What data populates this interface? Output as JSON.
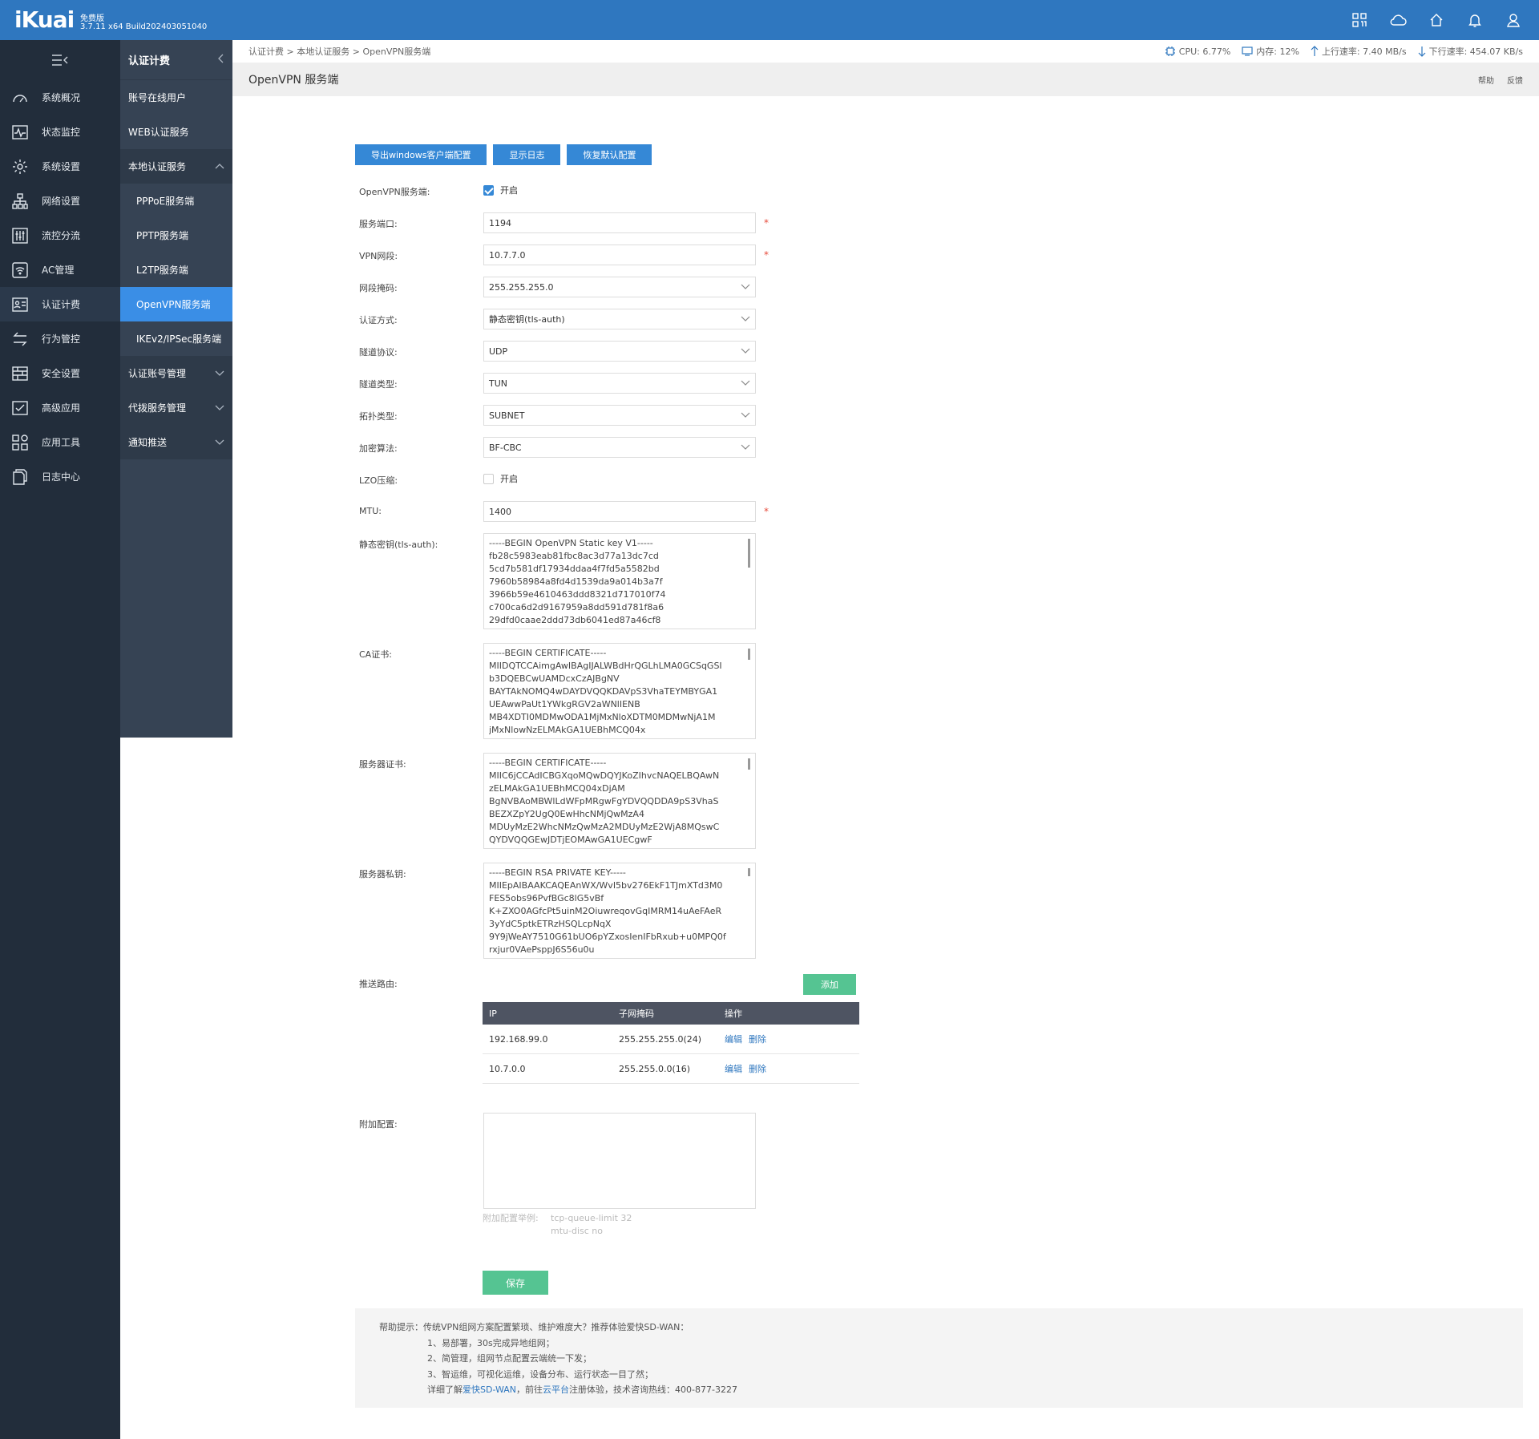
{
  "app": {
    "logo": "iKuai",
    "edition": "免费版",
    "version": "3.7.11 x64 Build202403051040"
  },
  "sidebar": {
    "items": [
      {
        "label": "系统概况",
        "icon": "dashboard-icon"
      },
      {
        "label": "状态监控",
        "icon": "monitor-icon"
      },
      {
        "label": "系统设置",
        "icon": "gear-icon"
      },
      {
        "label": "网络设置",
        "icon": "network-icon"
      },
      {
        "label": "流控分流",
        "icon": "sliders-icon"
      },
      {
        "label": "AC管理",
        "icon": "wifi-icon"
      },
      {
        "label": "认证计费",
        "icon": "id-card-icon"
      },
      {
        "label": "行为管控",
        "icon": "arrows-icon"
      },
      {
        "label": "安全设置",
        "icon": "firewall-icon"
      },
      {
        "label": "高级应用",
        "icon": "check-icon"
      },
      {
        "label": "应用工具",
        "icon": "apps-icon"
      },
      {
        "label": "日志中心",
        "icon": "docs-icon"
      }
    ]
  },
  "submenu": {
    "title": "认证计费",
    "items": [
      "账号在线用户",
      "WEB认证服务",
      "本地认证服务",
      "PPPoE服务端",
      "PPTP服务端",
      "L2TP服务端",
      "OpenVPN服务端",
      "IKEv2/IPSec服务端",
      "认证账号管理",
      "代拨服务管理",
      "通知推送"
    ]
  },
  "breadcrumb": {
    "a": "认证计费",
    "b": "本地认证服务",
    "c": "OpenVPN服务端",
    "sep": ">"
  },
  "stats": {
    "cpu": "CPU: 6.77%",
    "mem": "内存: 12%",
    "up": "上行速率: 7.40 MB/s",
    "down": "下行速率: 454.07 KB/s"
  },
  "page": {
    "title": "OpenVPN 服务端",
    "help": "帮助",
    "feedback": "反馈"
  },
  "buttons": {
    "export": "导出windows客户端配置",
    "log": "显示日志",
    "restore": "恢复默认配置",
    "add": "添加",
    "save": "保存"
  },
  "form": {
    "enable_label": "OpenVPN服务端:",
    "enable_text": "开启",
    "port_label": "服务端口:",
    "port": "1194",
    "net_label": "VPN网段:",
    "net": "10.7.7.0",
    "mask_label": "网段掩码:",
    "mask": "255.255.255.0",
    "auth_label": "认证方式:",
    "auth": "静态密钥(tls-auth)",
    "proto_label": "隧道协议:",
    "proto": "UDP",
    "tun_label": "隧道类型:",
    "tun": "TUN",
    "topo_label": "拓扑类型:",
    "topo": "SUBNET",
    "cipher_label": "加密算法:",
    "cipher": "BF-CBC",
    "lzo_label": "LZO压缩:",
    "lzo_text": "开启",
    "mtu_label": "MTU:",
    "mtu": "1400",
    "key_label": "静态密钥(tls-auth):",
    "ca_label": "CA证书:",
    "cert_label": "服务器证书:",
    "pkey_label": "服务器私钥:",
    "route_label": "推送路由:",
    "extra_label": "附加配置:",
    "extra_hint_label": "附加配置举例:",
    "extra_hint_1": "tcp-queue-limit 32",
    "extra_hint_2": "mtu-disc no",
    "required_mark": "*"
  },
  "static_key": [
    "-----BEGIN OpenVPN Static key V1-----",
    "fb28c5983eab81fbc8ac3d77a13dc7cd",
    "5cd7b581df17934ddaa4f7fd5a5582bd",
    "7960b58984a8fd4d1539da9a014b3a7f",
    "3966b59e4610463ddd8321d717010f74",
    "c700ca6d2d9167959a8dd591d781f8a6",
    "29dfd0caae2ddd73db6041ed87a46cf8"
  ],
  "ca_cert": [
    "-----BEGIN CERTIFICATE-----",
    "MIIDQTCCAimgAwIBAgIJALWBdHrQGLhLMA0GCSqGSI",
    "b3DQEBCwUAMDcxCzAJBgNV",
    "BAYTAkNOMQ4wDAYDVQQKDAVpS3VhaTEYMBYGA1",
    "UEAwwPaUt1YWkgRGV2aWNlIENB",
    "MB4XDTI0MDMwODA1MjMxNloXDTM0MDMwNjA1M",
    "jMxNlowNzELMAkGA1UEBhMCQ04x"
  ],
  "server_cert": [
    "-----BEGIN CERTIFICATE-----",
    "MIIC6jCCAdICBGXqoMQwDQYJKoZIhvcNAQELBQAwN",
    "zELMAkGA1UEBhMCQ04xDjAM",
    "BgNVBAoMBWlLdWFpMRgwFgYDVQQDDA9pS3VhaS",
    "BEZXZpY2UgQ0EwHhcNMjQwMzA4",
    "MDUyMzE2WhcNMzQwMzA2MDUyMzE2WjA8MQswC",
    "QYDVQQGEwJDTjEOMAwGA1UECgwF"
  ],
  "server_key": [
    "-----BEGIN RSA PRIVATE KEY-----",
    "MIIEpAIBAAKCAQEAnWX/WvI5bv276EkF1TJmXTd3M0",
    "FES5obs96PvfBGc8lG5vBf",
    "K+ZXO0AGfcPt5uinM2OiuwreqovGqIMRM14uAeFAeR",
    "3yYdC5ptkETRzHSQLcpNqX",
    "9Y9jWeAY7510G61bUO6pYZxosIenIFbRxub+u0MPQ0f",
    "rxjur0VAePsppJ6S56u0u"
  ],
  "routes": {
    "headers": {
      "ip": "IP",
      "mask": "子网掩码",
      "op": "操作"
    },
    "edit": "编辑",
    "del": "删除",
    "rows": [
      {
        "ip": "192.168.99.0",
        "mask": "255.255.255.0(24)"
      },
      {
        "ip": "10.7.0.0",
        "mask": "255.255.0.0(16)"
      }
    ]
  },
  "help": {
    "lead": "帮助提示：传统VPN组网方案配置繁琐、维护难度大？推荐体验爱快SD-WAN：",
    "l1": "1、易部署，30s完成异地组网；",
    "l2": "2、简管理，组网节点配置云端统一下发；",
    "l3": "3、智运维，可视化运维，设备分布、运行状态一目了然；",
    "l4a": "详细了解",
    "l4link1": "爱快SD-WAN",
    "l4b": "，前往",
    "l4link2": "云平台",
    "l4c": "注册体验，技术咨询热线：400-877-3227"
  },
  "colors": {
    "topbar": "#2f77bf",
    "sidebar": "#222d3b",
    "submenu": "#364354",
    "accent": "#3588d6",
    "green": "#55c492"
  }
}
